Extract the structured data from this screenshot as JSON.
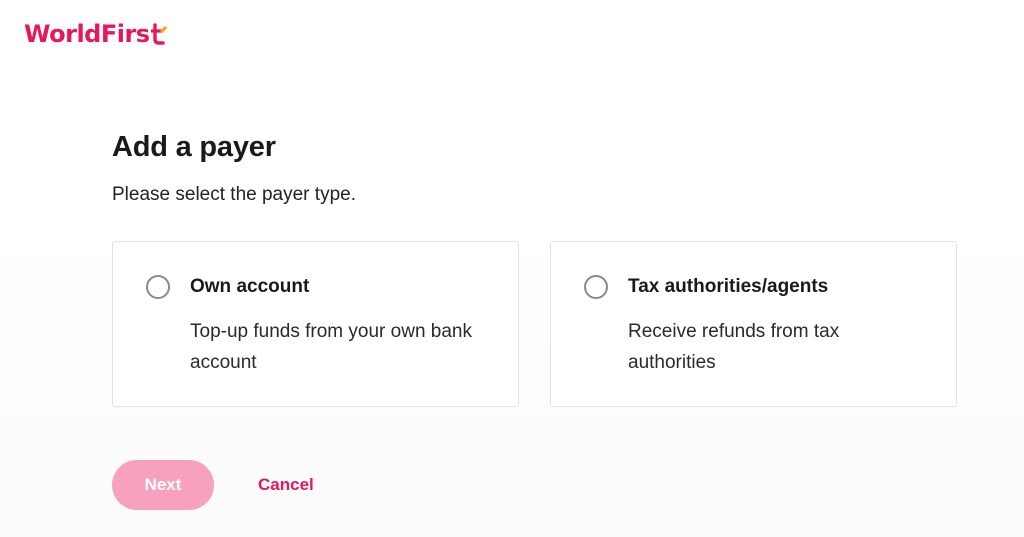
{
  "brand": {
    "name": "WorldFirs",
    "logo_color": "#e8175d",
    "logo_accent": "#f6a623"
  },
  "page": {
    "title": "Add a payer",
    "subtitle": "Please select the payer type."
  },
  "options": [
    {
      "title": "Own account",
      "description": "Top-up funds from your own bank account",
      "selected": false
    },
    {
      "title": "Tax authorities/agents",
      "description": "Receive refunds from tax authorities",
      "selected": false
    }
  ],
  "actions": {
    "next_label": "Next",
    "next_enabled": false,
    "cancel_label": "Cancel"
  },
  "colors": {
    "primary": "#e8175d",
    "primary_disabled": "#f7a1bf"
  }
}
